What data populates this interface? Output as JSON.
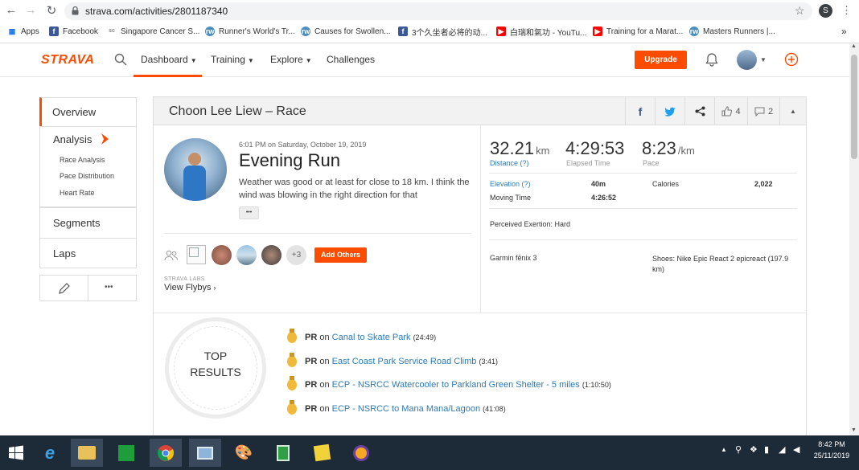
{
  "browser": {
    "url": "strava.com/activities/2801187340",
    "profile_initial": "S",
    "bookmarks": [
      "Apps",
      "Facebook",
      "Singapore Cancer S...",
      "Runner's World's Tr...",
      "Causes for Swollen...",
      "3个久坐者必将的动...",
      "白瑞和氣功 - YouTu...",
      "Training for a Marat...",
      "Masters Runners |..."
    ],
    "more": "»"
  },
  "strava": {
    "logo": "STRAVA",
    "nav": [
      "Dashboard",
      "Training",
      "Explore",
      "Challenges"
    ],
    "upgrade": "Upgrade"
  },
  "sidebar": {
    "overview": "Overview",
    "analysis": "Analysis",
    "analysis_items": [
      "Race Analysis",
      "Pace Distribution",
      "Heart Rate"
    ],
    "segments": "Segments",
    "laps": "Laps",
    "more": "•••"
  },
  "card": {
    "title": "Choon Lee Liew – Race",
    "kudos": "4",
    "comments": "2",
    "datetime": "6:01 PM on Saturday, October 19, 2019",
    "activity_title": "Evening Run",
    "description": "Weather was good or at least for close to 18 km. I think the wind was blowing in the right direction for that",
    "expand": "•••",
    "others_count": "+3",
    "add_others": "Add Others",
    "labs": "STRAVA LABS",
    "flybys": "View Flybys"
  },
  "stats": {
    "distance": "32.21",
    "distance_unit": "km",
    "distance_label": "Distance (?)",
    "elapsed": "4:29:53",
    "elapsed_label": "Elapsed Time",
    "pace": "8:23",
    "pace_unit": "/km",
    "pace_label": "Pace",
    "elevation_label": "Elevation (?)",
    "elevation": "40m",
    "calories_label": "Calories",
    "calories": "2,022",
    "moving_label": "Moving Time",
    "moving": "4:26:52",
    "exertion": "Perceived Exertion: Hard",
    "device": "Garmin fēnix 3",
    "shoes": "Shoes: Nike Epic React 2 epicreact (197.9 km)"
  },
  "top_results": {
    "title_line1": "TOP",
    "title_line2": "RESULTS",
    "items": [
      {
        "pr": "PR",
        "on": "on",
        "segment": "Canal to Skate Park",
        "time": "(24:49)"
      },
      {
        "pr": "PR",
        "on": "on",
        "segment": "East Coast Park Service Road Climb",
        "time": "(3:41)"
      },
      {
        "pr": "PR",
        "on": "on",
        "segment": "ECP - NSRCC Watercooler to Parkland Green Shelter - 5 miles",
        "time": "(1:10:50)"
      },
      {
        "pr": "PR",
        "on": "on",
        "segment": "ECP - NSRCC to Mana Mana/Lagoon",
        "time": "(41:08)"
      }
    ]
  },
  "taskbar": {
    "time": "8:42 PM",
    "date": "25/11/2019"
  },
  "colors": {
    "strava_orange": "#fc4c02",
    "link": "#2b7bb9"
  }
}
